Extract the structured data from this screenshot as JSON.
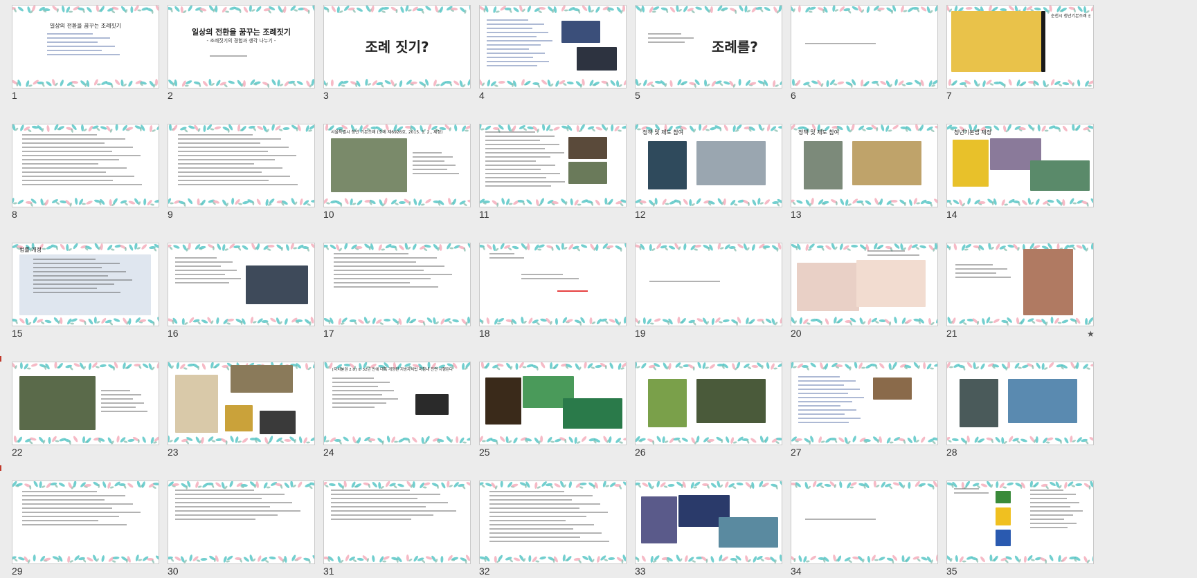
{
  "slides": [
    {
      "number": "1",
      "title": "일상의 전환을 꿈꾸는 조례짓기",
      "subtitle": "",
      "layout": "text-center-small",
      "photos": []
    },
    {
      "number": "2",
      "title": "일상의 전환을 꿈꾸는 조례짓기",
      "subtitle": "- 조례짓기의 경험과 생각 나누기 -",
      "layout": "title",
      "photos": []
    },
    {
      "number": "3",
      "title": "조례 짓기?",
      "subtitle": "",
      "layout": "big",
      "photos": []
    },
    {
      "number": "4",
      "title": "",
      "subtitle": "",
      "layout": "list-photo",
      "photos": [
        "#3b4f7a",
        "#2d3340"
      ]
    },
    {
      "number": "5",
      "title": "조례를?",
      "subtitle": "",
      "layout": "big-right",
      "photos": []
    },
    {
      "number": "6",
      "title": "",
      "subtitle": "",
      "layout": "one-line",
      "photos": []
    },
    {
      "number": "7",
      "title": "순천시 청년기본조례 공청회",
      "subtitle": "",
      "layout": "poster",
      "photos": [
        "#e9c24a",
        "#1a1a1a"
      ]
    },
    {
      "number": "8",
      "title": "",
      "subtitle": "",
      "layout": "doc",
      "photos": []
    },
    {
      "number": "9",
      "title": "",
      "subtitle": "",
      "layout": "doc",
      "photos": []
    },
    {
      "number": "10",
      "title": "서울특별시 청년 기본조례 (조례 제6926호, 2015. 1. 2., 제정)",
      "subtitle": "",
      "layout": "photo-left",
      "photos": [
        "#7a8a6a"
      ]
    },
    {
      "number": "11",
      "title": "",
      "subtitle": "",
      "layout": "doc-photos",
      "photos": [
        "#5a4a3a",
        "#6a7a5a"
      ]
    },
    {
      "number": "12",
      "title": "정책 및 제도 참여",
      "subtitle": "",
      "layout": "photos2",
      "photos": [
        "#2f4a5c",
        "#9aa6b0"
      ]
    },
    {
      "number": "13",
      "title": "정책 및 제도 참여",
      "subtitle": "",
      "layout": "photos2",
      "photos": [
        "#7c8a7a",
        "#bfa36a"
      ]
    },
    {
      "number": "14",
      "title": "청년기본법 제정",
      "subtitle": "",
      "layout": "collage",
      "photos": [
        "#e8c12a",
        "#8a7a9a",
        "#5a8a6a"
      ]
    },
    {
      "number": "15",
      "title": "법률 개정",
      "subtitle": "",
      "layout": "screenshot",
      "photos": [
        "#dfe6ef"
      ]
    },
    {
      "number": "16",
      "title": "",
      "subtitle": "",
      "layout": "photo-right",
      "photos": [
        "#3e4a5a"
      ]
    },
    {
      "number": "17",
      "title": "",
      "subtitle": "",
      "layout": "table",
      "photos": []
    },
    {
      "number": "18",
      "title": "",
      "subtitle": "",
      "layout": "red-text",
      "photos": []
    },
    {
      "number": "19",
      "title": "",
      "subtitle": "",
      "layout": "one-line",
      "photos": []
    },
    {
      "number": "20",
      "title": "",
      "subtitle": "",
      "layout": "baby",
      "photos": [
        "#e9d0c6",
        "#f2dcd0"
      ]
    },
    {
      "number": "21",
      "title": "",
      "subtitle": "",
      "layout": "photo-right-tall",
      "photos": [
        "#b07a62"
      ]
    },
    {
      "number": "22",
      "title": "",
      "subtitle": "",
      "layout": "photo-left",
      "photos": [
        "#5a6a4a"
      ]
    },
    {
      "number": "23",
      "title": "",
      "subtitle": "",
      "layout": "cert",
      "photos": [
        "#d9c9a9",
        "#8a7a5a",
        "#caa23a"
      ]
    },
    {
      "number": "24",
      "title": "[자치분권 2.0] ① 32년 만에 대폭 개정된 지방자치법 마침내 전면 시행된다",
      "subtitle": "",
      "layout": "news",
      "photos": [
        "#2a2a2a"
      ]
    },
    {
      "number": "25",
      "title": "",
      "subtitle": "",
      "layout": "collage",
      "photos": [
        "#3a2a1a",
        "#4a9a5a",
        "#2a7a4a"
      ]
    },
    {
      "number": "26",
      "title": "",
      "subtitle": "",
      "layout": "photos2",
      "photos": [
        "#7aa04a",
        "#4a5a3a"
      ]
    },
    {
      "number": "27",
      "title": "",
      "subtitle": "",
      "layout": "list-photo",
      "photos": [
        "#8a6a4a"
      ]
    },
    {
      "number": "28",
      "title": "",
      "subtitle": "",
      "layout": "photos2",
      "photos": [
        "#4a5a5a",
        "#5a8ab0"
      ]
    },
    {
      "number": "29",
      "title": "",
      "subtitle": "",
      "layout": "table",
      "photos": []
    },
    {
      "number": "30",
      "title": "",
      "subtitle": "",
      "layout": "doc-text",
      "photos": []
    },
    {
      "number": "31",
      "title": "",
      "subtitle": "",
      "layout": "doc-text",
      "photos": []
    },
    {
      "number": "32",
      "title": "",
      "subtitle": "",
      "layout": "doc",
      "photos": []
    },
    {
      "number": "33",
      "title": "",
      "subtitle": "",
      "layout": "collage",
      "photos": [
        "#5a5a8a",
        "#2a3a6a",
        "#5a8aa0"
      ]
    },
    {
      "number": "34",
      "title": "",
      "subtitle": "",
      "layout": "one-line",
      "photos": []
    },
    {
      "number": "35",
      "title": "",
      "subtitle": "",
      "layout": "diagram",
      "photos": [
        "#3a8a3a",
        "#f0c020",
        "#2a5ab0"
      ]
    }
  ],
  "star_slide": "21",
  "star_symbol": "★",
  "colors": {
    "background": "#ececec",
    "accent": "#d83b01",
    "leaf_teal": "#4fc3c3",
    "leaf_pink": "#f4a9b8"
  }
}
